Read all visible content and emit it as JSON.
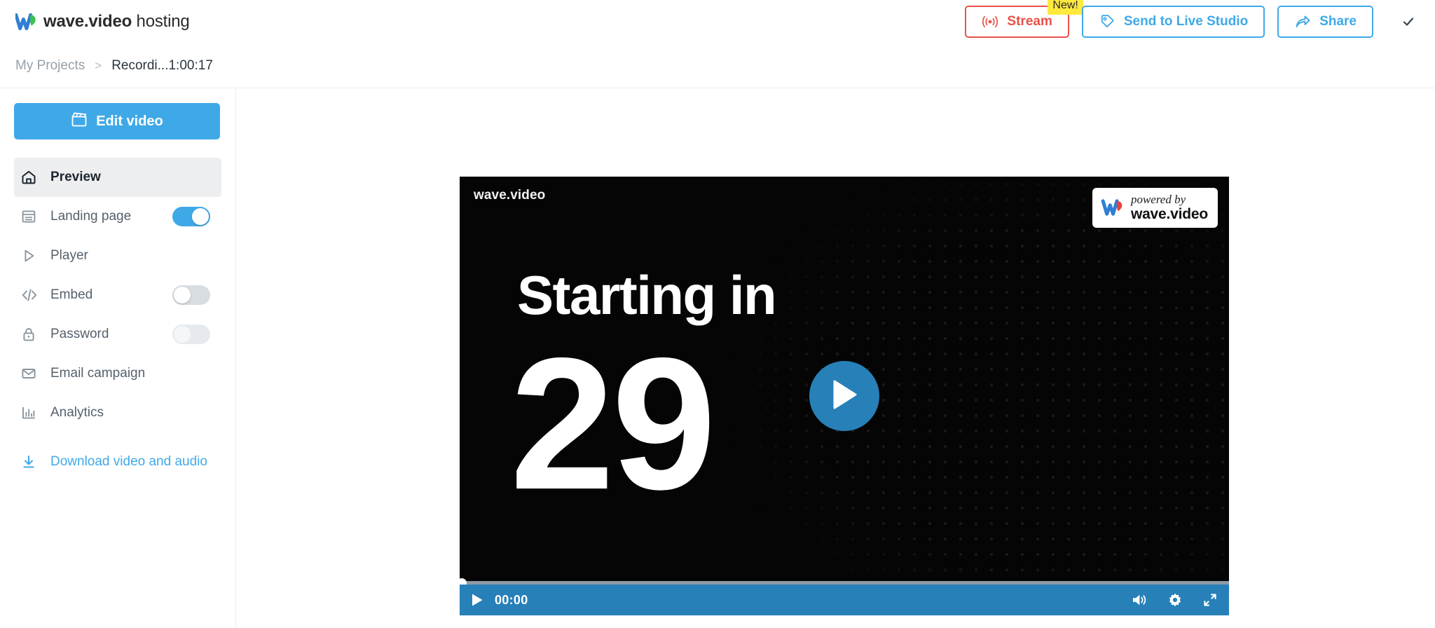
{
  "header": {
    "brand_bold": "wave.video",
    "brand_light": " hosting",
    "logo_icon": "wave-w-logo-icon",
    "buttons": [
      {
        "label": "Stream",
        "icon": "broadcast-icon",
        "badge": "New!",
        "color": "#e8524a"
      },
      {
        "label": "Send to Live Studio",
        "icon": "tag-icon",
        "color": "#3fa9e8"
      },
      {
        "label": "Share",
        "icon": "share-arrow-icon",
        "color": "#3fa9e8"
      }
    ],
    "check_icon": "check-icon"
  },
  "breadcrumb": {
    "root": "My Projects",
    "separator": ">",
    "current": "Recordi...1:00:17"
  },
  "sidebar": {
    "edit_button": {
      "label": "Edit video",
      "icon": "clapperboard-icon"
    },
    "items": [
      {
        "label": "Preview",
        "icon": "home-icon",
        "active": true,
        "toggle": null
      },
      {
        "label": "Landing page",
        "icon": "landing-page-icon",
        "active": false,
        "toggle": "on"
      },
      {
        "label": "Player",
        "icon": "play-outline-icon",
        "active": false,
        "toggle": null
      },
      {
        "label": "Embed",
        "icon": "code-icon",
        "active": false,
        "toggle": "off"
      },
      {
        "label": "Password",
        "icon": "lock-icon",
        "active": false,
        "toggle": "off-light"
      },
      {
        "label": "Email campaign",
        "icon": "envelope-icon",
        "active": false,
        "toggle": null
      },
      {
        "label": "Analytics",
        "icon": "bar-chart-icon",
        "active": false,
        "toggle": null
      }
    ],
    "download": {
      "label": "Download video and audio",
      "icon": "download-icon"
    }
  },
  "player": {
    "watermark": "wave.video",
    "powered_by": {
      "line1": "powered by",
      "line2": "wave.video",
      "logo_icon": "wave-w-logo-icon"
    },
    "slide": {
      "title": "Starting in",
      "count": "29"
    },
    "play_button_icon": "play-icon",
    "controls": {
      "play_icon": "play-icon",
      "time": "00:00",
      "progress_percent": 0,
      "volume_icon": "volume-icon",
      "settings_icon": "gear-icon",
      "fullscreen_icon": "fullscreen-icon"
    }
  },
  "colors": {
    "accent_blue": "#3fa9e8",
    "player_blue": "#2780b8",
    "stream_red": "#e8524a",
    "badge_yellow": "#ffe93d"
  }
}
